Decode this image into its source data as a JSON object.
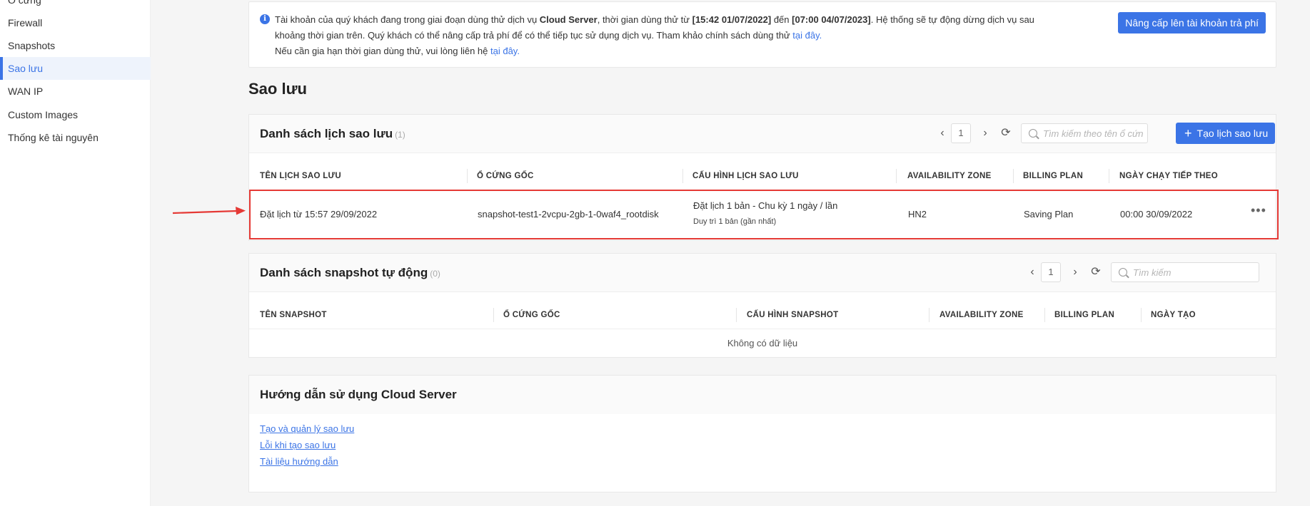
{
  "sidebar": {
    "items": [
      {
        "label": "Ổ cứng"
      },
      {
        "label": "Firewall"
      },
      {
        "label": "Snapshots"
      },
      {
        "label": "Sao lưu"
      },
      {
        "label": "WAN IP"
      },
      {
        "label": "Custom Images"
      },
      {
        "label": "Thống kê tài nguyên"
      }
    ],
    "active_index": 3
  },
  "notice": {
    "line1_a": "Tài khoản của quý khách đang trong giai đoạn dùng thử dịch vụ ",
    "service": "Cloud Server",
    "line1_b": ", thời gian dùng thử từ ",
    "start": "[15:42 01/07/2022]",
    "line1_c": " đến ",
    "end": "[07:00 04/07/2023]",
    "line1_d": ". Hệ thống sẽ tự động dừng dịch vụ sau",
    "line2": "khoảng thời gian trên. Quý khách có thể nâng cấp trả phí để có thể tiếp tục sử dụng dịch vụ. Tham khảo chính sách dùng thử ",
    "line2_link": "tại đây.",
    "line3": "Nếu cần gia hạn thời gian dùng thử, vui lòng liên hệ ",
    "line3_link": "tại đây.",
    "upgrade_button": "Nâng cấp lên tài khoản trả phí"
  },
  "page_title": "Sao lưu",
  "backup_schedules": {
    "title": "Danh sách lịch sao lưu",
    "count": "(1)",
    "page": "1",
    "search_placeholder": "Tìm kiếm theo tên ổ cứng",
    "create_button": "Tạo lịch sao lưu",
    "columns": [
      "TÊN LỊCH SAO LƯU",
      "Ổ CỨNG GỐC",
      "CẤU HÌNH LỊCH SAO LƯU",
      "AVAILABILITY ZONE",
      "BILLING PLAN",
      "NGÀY CHẠY TIẾP THEO"
    ],
    "rows": [
      {
        "name": "Đặt lịch từ 15:57 29/09/2022",
        "disk": "snapshot-test1-2vcpu-2gb-1-0waf4_rootdisk",
        "config": "Đặt lịch 1 bản - Chu kỳ 1 ngày / lần",
        "config_sub": "Duy trì 1 bản (gần nhất)",
        "zone": "HN2",
        "billing": "Saving Plan",
        "next_run": "00:00 30/09/2022"
      }
    ]
  },
  "auto_snapshots": {
    "title": "Danh sách snapshot tự động",
    "count": "(0)",
    "page": "1",
    "search_placeholder": "Tìm kiếm",
    "columns": [
      "TÊN SNAPSHOT",
      "Ổ CỨNG GỐC",
      "CẤU HÌNH SNAPSHOT",
      "AVAILABILITY ZONE",
      "BILLING PLAN",
      "NGÀY TẠO"
    ],
    "empty_text": "Không có dữ liệu"
  },
  "guide": {
    "title": "Hướng dẫn sử dụng Cloud Server",
    "links": [
      "Tạo và quản lý sao lưu",
      "Lỗi khi tạo sao lưu",
      "Tài liệu hướng dẫn"
    ]
  },
  "colors": {
    "accent": "#3b74e6",
    "highlight": "#e53935"
  }
}
